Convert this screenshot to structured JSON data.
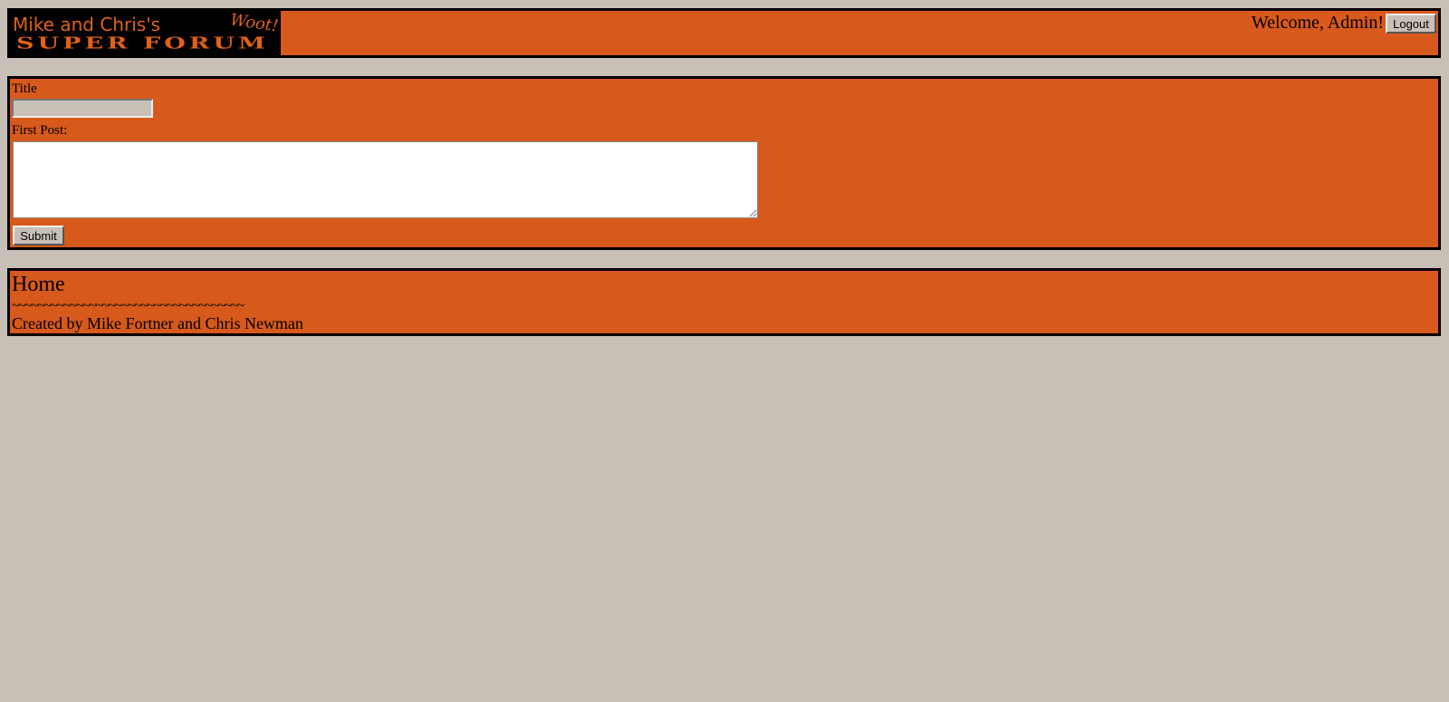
{
  "header": {
    "logo": {
      "line1": "Mike and Chris's",
      "tagline": "Woot!",
      "line2": "SUPER FORUM"
    },
    "welcome_text": "Welcome, Admin!",
    "logout_label": "Logout"
  },
  "form": {
    "title_label": "Title",
    "title_value": "",
    "first_post_label": "First Post:",
    "first_post_value": "",
    "submit_label": "Submit"
  },
  "footer": {
    "home_title": "Home",
    "divider": "~~~~~~~~~~~~~~~~~~~~~~~~~~~~~~~~~~~~",
    "credits": "Created by Mike Fortner and Chris Newman"
  },
  "colors": {
    "page_background": "#c8c0b7",
    "panel_background": "#d7591b",
    "logo_background": "#000000",
    "logo_text": "#e06218"
  }
}
